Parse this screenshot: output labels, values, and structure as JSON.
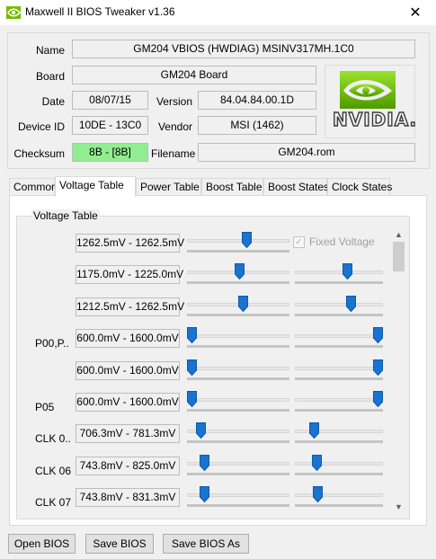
{
  "window": {
    "title": "Maxwell II BIOS Tweaker v1.36",
    "close_glyph": "✕"
  },
  "info": {
    "name_label": "Name",
    "name_value": "GM204 VBIOS (HWDIAG) MSINV317MH.1C0",
    "board_label": "Board",
    "board_value": "GM204 Board",
    "date_label": "Date",
    "date_value": "08/07/15",
    "version_label": "Version",
    "version_value": "84.04.84.00.1D",
    "device_label": "Device ID",
    "device_value": "10DE - 13C0",
    "vendor_label": "Vendor",
    "vendor_value": "MSI (1462)",
    "checksum_label": "Checksum",
    "checksum_value": "8B - [8B]",
    "filename_label": "Filename",
    "filename_value": "GM204.rom",
    "logo_text": "NVIDIA."
  },
  "tabs": [
    {
      "label": "Common",
      "active": false
    },
    {
      "label": "Voltage Table",
      "active": true
    },
    {
      "label": "Power Table",
      "active": false
    },
    {
      "label": "Boost Table",
      "active": false
    },
    {
      "label": "Boost States",
      "active": false
    },
    {
      "label": "Clock States",
      "active": false
    }
  ],
  "voltage_table": {
    "group_title": "Voltage Table",
    "fixed_voltage_label": "Fixed Voltage",
    "fixed_voltage_checked": true,
    "rows": [
      {
        "label": "",
        "value": "1262.5mV - 1262.5mV",
        "slider1": 0.59,
        "slider2": null
      },
      {
        "label": "",
        "value": "1175.0mV - 1225.0mV",
        "slider1": 0.51,
        "slider2": 0.61
      },
      {
        "label": "",
        "value": "1212.5mV - 1262.5mV",
        "slider1": 0.55,
        "slider2": 0.65
      },
      {
        "label": "P00,P..",
        "value": "600.0mV - 1600.0mV",
        "slider1": 0.0,
        "slider2": 1.0
      },
      {
        "label": "",
        "value": "600.0mV - 1600.0mV",
        "slider1": 0.0,
        "slider2": 1.0
      },
      {
        "label": "P05",
        "value": "600.0mV - 1600.0mV",
        "slider1": 0.0,
        "slider2": 1.0
      },
      {
        "label": "CLK 0..",
        "value": "706.3mV - 781.3mV",
        "slider1": 0.1,
        "slider2": 0.18
      },
      {
        "label": "CLK 06",
        "value": "743.8mV - 825.0mV",
        "slider1": 0.14,
        "slider2": 0.22
      },
      {
        "label": "CLK 07",
        "value": "743.8mV - 831.3mV",
        "slider1": 0.14,
        "slider2": 0.23
      }
    ]
  },
  "buttons": {
    "open": "Open BIOS",
    "save": "Save BIOS",
    "save_as": "Save BIOS As"
  },
  "colors": {
    "checksum_bg": "#90ee90",
    "thumb_blue": "#1a73d1",
    "nvidia_green": "#76b900"
  }
}
